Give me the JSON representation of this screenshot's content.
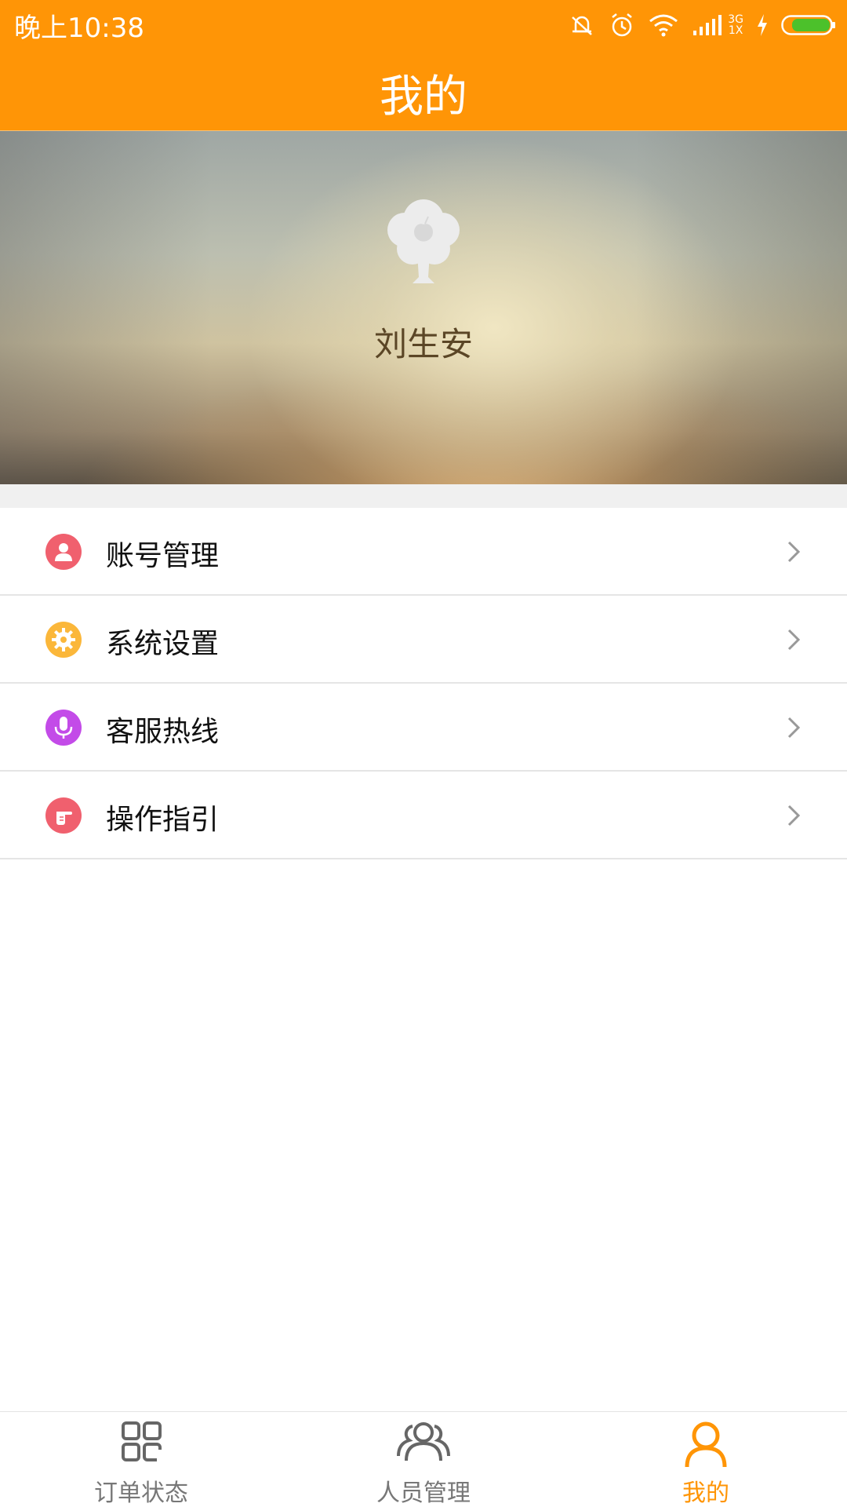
{
  "status_bar": {
    "time": "晚上10:38",
    "network_top": "3G",
    "network_bottom": "1X",
    "icons": [
      "mute-icon",
      "alarm-icon",
      "wifi-icon",
      "signal-icon",
      "charging-icon",
      "battery-icon"
    ]
  },
  "header": {
    "title": "我的"
  },
  "profile": {
    "name": "刘生安",
    "avatar_icon": "tree-avatar-icon"
  },
  "menu": {
    "items": [
      {
        "label": "账号管理",
        "icon": "user-icon",
        "color": "#F0606E"
      },
      {
        "label": "系统设置",
        "icon": "gear-icon",
        "color": "#FBB73A"
      },
      {
        "label": "客服热线",
        "icon": "microphone-icon",
        "color": "#C34BE8"
      },
      {
        "label": "操作指引",
        "icon": "pointing-hand-icon",
        "color": "#F0606E"
      }
    ]
  },
  "bottom_nav": {
    "items": [
      {
        "label": "订单状态",
        "icon": "grid-icon",
        "active": false
      },
      {
        "label": "人员管理",
        "icon": "people-icon",
        "active": false
      },
      {
        "label": "我的",
        "icon": "person-icon",
        "active": true
      }
    ]
  },
  "colors": {
    "accent": "#FF9506",
    "inactive": "#777777"
  }
}
